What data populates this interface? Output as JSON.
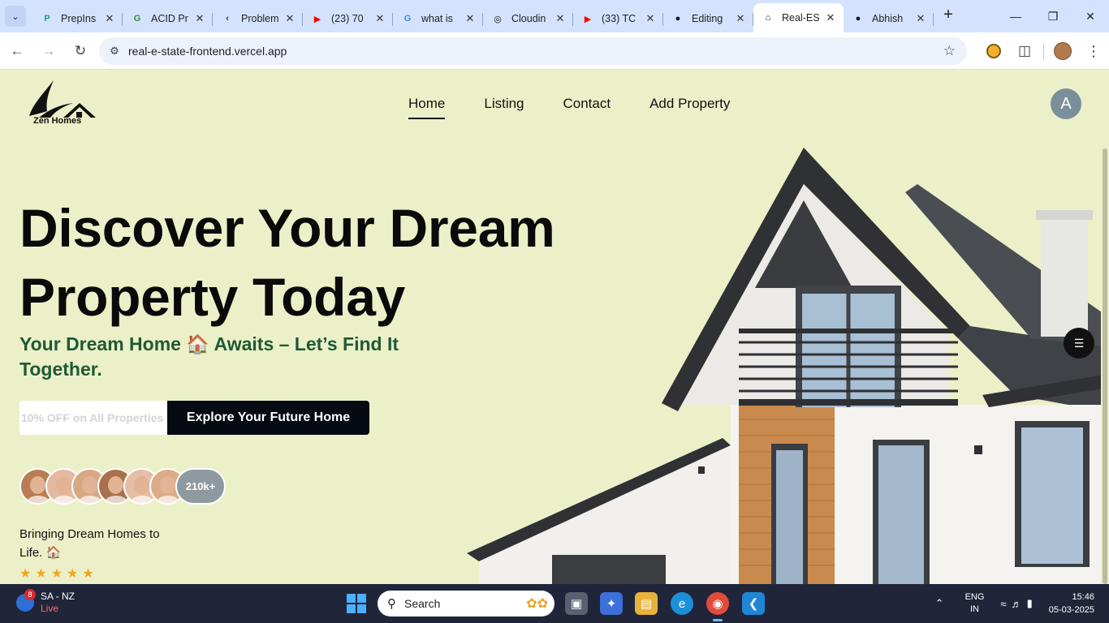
{
  "browser": {
    "tabs": [
      {
        "title": "PrepIns",
        "icon": "prepinsta-icon",
        "color": "#1aa380",
        "glyph": "P",
        "active": false
      },
      {
        "title": "ACID Pr",
        "icon": "gfg-icon",
        "color": "#2f8d46",
        "glyph": "G",
        "active": false
      },
      {
        "title": "Problem",
        "icon": "leetcode-icon",
        "color": "#333333",
        "glyph": "‹",
        "active": false
      },
      {
        "title": "(23) 70",
        "icon": "youtube-icon",
        "color": "#ff0000",
        "glyph": "▶",
        "active": false
      },
      {
        "title": "what is",
        "icon": "google-icon",
        "color": "#4285f4",
        "glyph": "G",
        "active": false
      },
      {
        "title": "Cloudin",
        "icon": "openai-icon",
        "color": "#111111",
        "glyph": "◎",
        "active": false
      },
      {
        "title": "(33) TC",
        "icon": "youtube-icon",
        "color": "#ff0000",
        "glyph": "▶",
        "active": false
      },
      {
        "title": "Editing",
        "icon": "github-icon",
        "color": "#111111",
        "glyph": "●",
        "active": false
      },
      {
        "title": "Real-ES",
        "icon": "home-icon",
        "color": "#111111",
        "glyph": "⌂",
        "active": true
      },
      {
        "title": "Abhish",
        "icon": "github-icon",
        "color": "#111111",
        "glyph": "●",
        "active": false
      }
    ],
    "url": "real-e-state-frontend.vercel.app"
  },
  "site": {
    "logo_text": "Zen Homes",
    "nav": [
      "Home",
      "Listing",
      "Contact",
      "Add Property"
    ],
    "active_nav": "Home",
    "avatar_letter": "A",
    "hero": {
      "title": "Discover Your Dream Property Today",
      "subtitle": "Your Dream Home 🏠 Awaits – Let’s Find It Together.",
      "input_placeholder": "10% OFF on All Properties",
      "button": "Explore Your Future Home",
      "customer_count": "210k+",
      "tagline": "Bringing Dream Homes to Life. 🏠",
      "rating": 5
    }
  },
  "taskbar": {
    "weather_badge": "8",
    "weather_line1": "SA - NZ",
    "weather_line2": "Live",
    "search_label": "Search",
    "lang_line1": "ENG",
    "lang_line2": "IN",
    "time": "15:46",
    "date": "05-03-2025"
  }
}
